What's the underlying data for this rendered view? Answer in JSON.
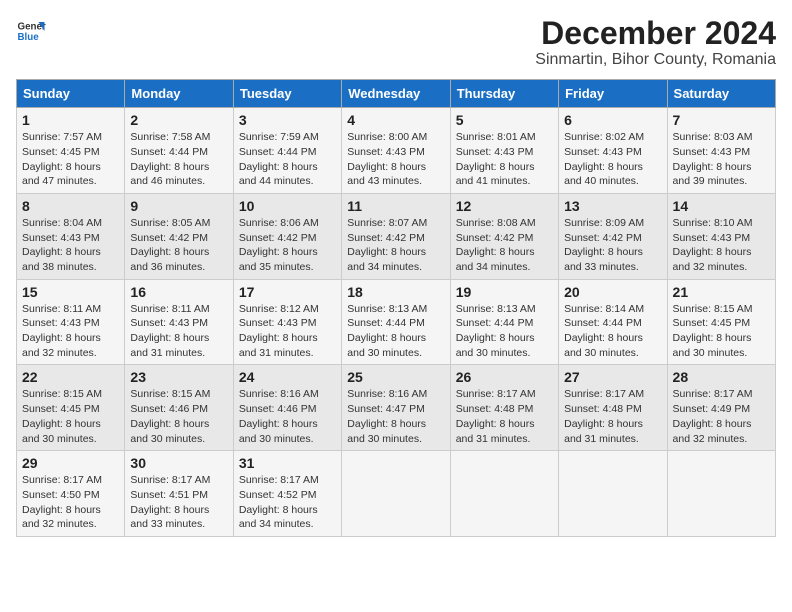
{
  "logo": {
    "line1": "General",
    "line2": "Blue"
  },
  "title": "December 2024",
  "subtitle": "Sinmartin, Bihor County, Romania",
  "header": {
    "days": [
      "Sunday",
      "Monday",
      "Tuesday",
      "Wednesday",
      "Thursday",
      "Friday",
      "Saturday"
    ]
  },
  "weeks": [
    [
      {
        "day": "1",
        "sunrise": "Sunrise: 7:57 AM",
        "sunset": "Sunset: 4:45 PM",
        "daylight": "Daylight: 8 hours and 47 minutes."
      },
      {
        "day": "2",
        "sunrise": "Sunrise: 7:58 AM",
        "sunset": "Sunset: 4:44 PM",
        "daylight": "Daylight: 8 hours and 46 minutes."
      },
      {
        "day": "3",
        "sunrise": "Sunrise: 7:59 AM",
        "sunset": "Sunset: 4:44 PM",
        "daylight": "Daylight: 8 hours and 44 minutes."
      },
      {
        "day": "4",
        "sunrise": "Sunrise: 8:00 AM",
        "sunset": "Sunset: 4:43 PM",
        "daylight": "Daylight: 8 hours and 43 minutes."
      },
      {
        "day": "5",
        "sunrise": "Sunrise: 8:01 AM",
        "sunset": "Sunset: 4:43 PM",
        "daylight": "Daylight: 8 hours and 41 minutes."
      },
      {
        "day": "6",
        "sunrise": "Sunrise: 8:02 AM",
        "sunset": "Sunset: 4:43 PM",
        "daylight": "Daylight: 8 hours and 40 minutes."
      },
      {
        "day": "7",
        "sunrise": "Sunrise: 8:03 AM",
        "sunset": "Sunset: 4:43 PM",
        "daylight": "Daylight: 8 hours and 39 minutes."
      }
    ],
    [
      {
        "day": "8",
        "sunrise": "Sunrise: 8:04 AM",
        "sunset": "Sunset: 4:43 PM",
        "daylight": "Daylight: 8 hours and 38 minutes."
      },
      {
        "day": "9",
        "sunrise": "Sunrise: 8:05 AM",
        "sunset": "Sunset: 4:42 PM",
        "daylight": "Daylight: 8 hours and 36 minutes."
      },
      {
        "day": "10",
        "sunrise": "Sunrise: 8:06 AM",
        "sunset": "Sunset: 4:42 PM",
        "daylight": "Daylight: 8 hours and 35 minutes."
      },
      {
        "day": "11",
        "sunrise": "Sunrise: 8:07 AM",
        "sunset": "Sunset: 4:42 PM",
        "daylight": "Daylight: 8 hours and 34 minutes."
      },
      {
        "day": "12",
        "sunrise": "Sunrise: 8:08 AM",
        "sunset": "Sunset: 4:42 PM",
        "daylight": "Daylight: 8 hours and 34 minutes."
      },
      {
        "day": "13",
        "sunrise": "Sunrise: 8:09 AM",
        "sunset": "Sunset: 4:42 PM",
        "daylight": "Daylight: 8 hours and 33 minutes."
      },
      {
        "day": "14",
        "sunrise": "Sunrise: 8:10 AM",
        "sunset": "Sunset: 4:43 PM",
        "daylight": "Daylight: 8 hours and 32 minutes."
      }
    ],
    [
      {
        "day": "15",
        "sunrise": "Sunrise: 8:11 AM",
        "sunset": "Sunset: 4:43 PM",
        "daylight": "Daylight: 8 hours and 32 minutes."
      },
      {
        "day": "16",
        "sunrise": "Sunrise: 8:11 AM",
        "sunset": "Sunset: 4:43 PM",
        "daylight": "Daylight: 8 hours and 31 minutes."
      },
      {
        "day": "17",
        "sunrise": "Sunrise: 8:12 AM",
        "sunset": "Sunset: 4:43 PM",
        "daylight": "Daylight: 8 hours and 31 minutes."
      },
      {
        "day": "18",
        "sunrise": "Sunrise: 8:13 AM",
        "sunset": "Sunset: 4:44 PM",
        "daylight": "Daylight: 8 hours and 30 minutes."
      },
      {
        "day": "19",
        "sunrise": "Sunrise: 8:13 AM",
        "sunset": "Sunset: 4:44 PM",
        "daylight": "Daylight: 8 hours and 30 minutes."
      },
      {
        "day": "20",
        "sunrise": "Sunrise: 8:14 AM",
        "sunset": "Sunset: 4:44 PM",
        "daylight": "Daylight: 8 hours and 30 minutes."
      },
      {
        "day": "21",
        "sunrise": "Sunrise: 8:15 AM",
        "sunset": "Sunset: 4:45 PM",
        "daylight": "Daylight: 8 hours and 30 minutes."
      }
    ],
    [
      {
        "day": "22",
        "sunrise": "Sunrise: 8:15 AM",
        "sunset": "Sunset: 4:45 PM",
        "daylight": "Daylight: 8 hours and 30 minutes."
      },
      {
        "day": "23",
        "sunrise": "Sunrise: 8:15 AM",
        "sunset": "Sunset: 4:46 PM",
        "daylight": "Daylight: 8 hours and 30 minutes."
      },
      {
        "day": "24",
        "sunrise": "Sunrise: 8:16 AM",
        "sunset": "Sunset: 4:46 PM",
        "daylight": "Daylight: 8 hours and 30 minutes."
      },
      {
        "day": "25",
        "sunrise": "Sunrise: 8:16 AM",
        "sunset": "Sunset: 4:47 PM",
        "daylight": "Daylight: 8 hours and 30 minutes."
      },
      {
        "day": "26",
        "sunrise": "Sunrise: 8:17 AM",
        "sunset": "Sunset: 4:48 PM",
        "daylight": "Daylight: 8 hours and 31 minutes."
      },
      {
        "day": "27",
        "sunrise": "Sunrise: 8:17 AM",
        "sunset": "Sunset: 4:48 PM",
        "daylight": "Daylight: 8 hours and 31 minutes."
      },
      {
        "day": "28",
        "sunrise": "Sunrise: 8:17 AM",
        "sunset": "Sunset: 4:49 PM",
        "daylight": "Daylight: 8 hours and 32 minutes."
      }
    ],
    [
      {
        "day": "29",
        "sunrise": "Sunrise: 8:17 AM",
        "sunset": "Sunset: 4:50 PM",
        "daylight": "Daylight: 8 hours and 32 minutes."
      },
      {
        "day": "30",
        "sunrise": "Sunrise: 8:17 AM",
        "sunset": "Sunset: 4:51 PM",
        "daylight": "Daylight: 8 hours and 33 minutes."
      },
      {
        "day": "31",
        "sunrise": "Sunrise: 8:17 AM",
        "sunset": "Sunset: 4:52 PM",
        "daylight": "Daylight: 8 hours and 34 minutes."
      },
      null,
      null,
      null,
      null
    ]
  ]
}
